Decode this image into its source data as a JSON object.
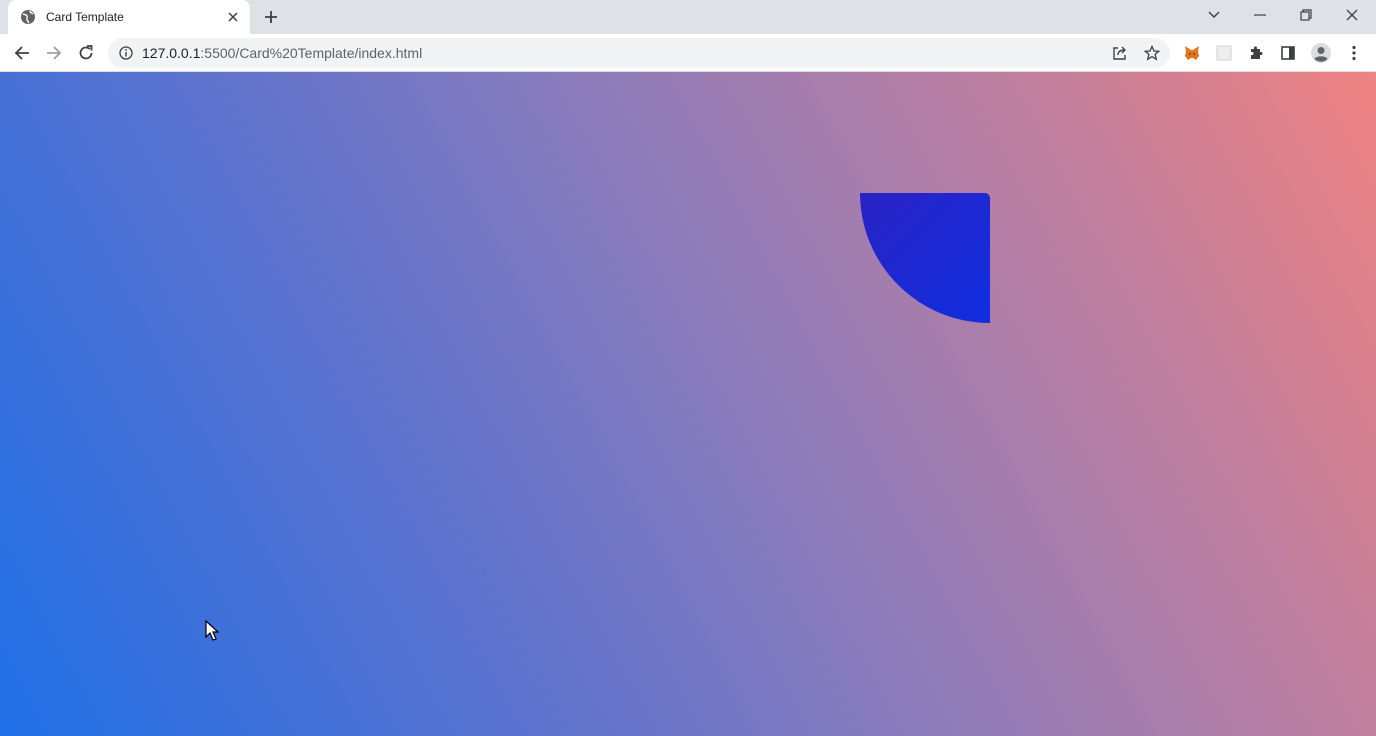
{
  "browser": {
    "tab": {
      "title": "Card Template",
      "favicon": "globe-icon"
    },
    "new_tab_icon": "plus-icon",
    "window_controls": [
      "chevron-down-icon",
      "minimize-icon",
      "restore-icon",
      "close-icon"
    ],
    "toolbar": {
      "back_icon": "arrow-left-icon",
      "forward_icon": "arrow-right-icon",
      "reload_icon": "reload-icon",
      "info_icon": "info-icon",
      "url_host": "127.0.0.1",
      "url_rest": ":5500/Card%20Template/index.html",
      "right_icons": [
        "share-icon",
        "star-icon",
        "metamask-fox-icon",
        "extension-placeholder-icon",
        "puzzle-icon",
        "sidepanel-icon",
        "profile-icon",
        "kebab-menu-icon"
      ]
    }
  },
  "page": {
    "background": {
      "from": "#1f6fe6",
      "via": "#8e7cba",
      "to": "#ef8282"
    },
    "shape": {
      "color_start": "#2a22c4",
      "color_end": "#0f2ee0"
    }
  }
}
